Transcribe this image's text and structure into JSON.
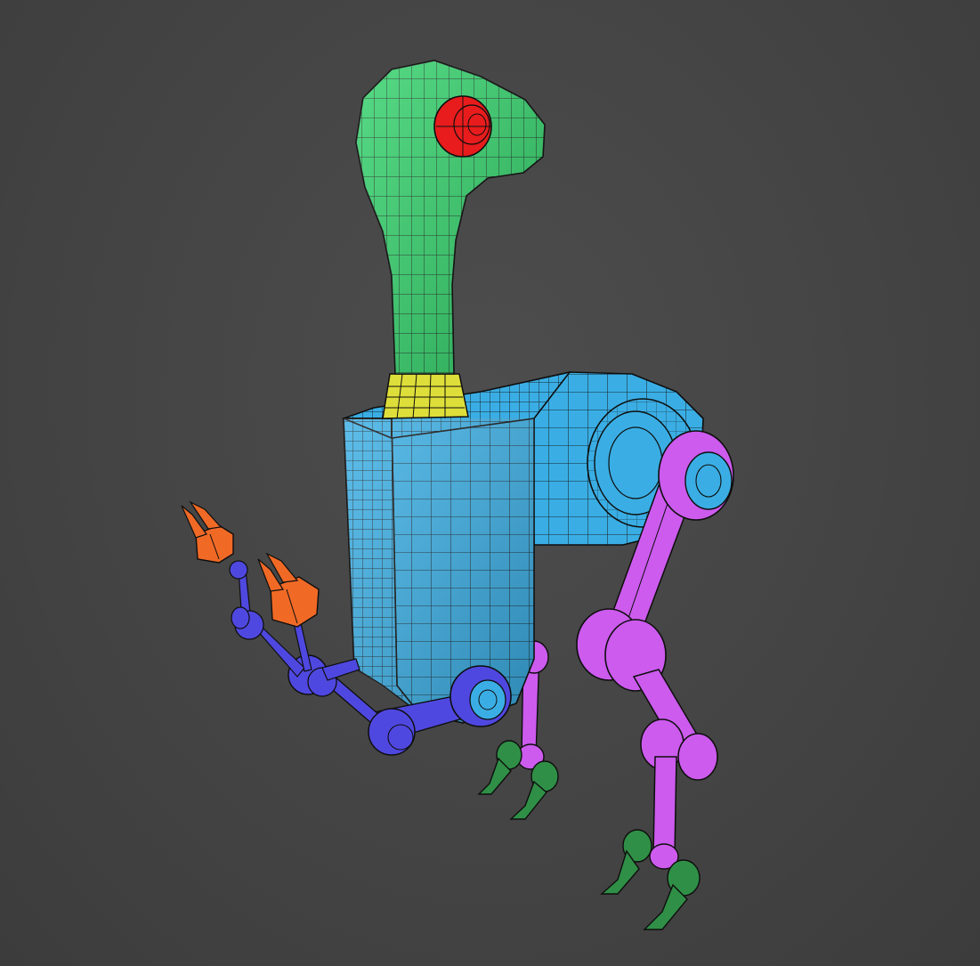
{
  "viewport": {
    "background": "#464646"
  },
  "palette": {
    "head": "#32d16a",
    "eye": "#e81c1c",
    "collar": "#dede3a",
    "body": "#3aaee4",
    "rear_legs": "#cc5bee",
    "front_arms": "#4f48e0",
    "claws": "#f06a26",
    "feet": "#2f8f46",
    "wire": "#0e0e0e"
  },
  "model": {
    "parts": [
      {
        "name": "head",
        "color_key": "head"
      },
      {
        "name": "eye",
        "color_key": "eye"
      },
      {
        "name": "neck-collar",
        "color_key": "collar"
      },
      {
        "name": "torso",
        "color_key": "body"
      },
      {
        "name": "hip-joint",
        "color_key": "body"
      },
      {
        "name": "rear-legs",
        "color_key": "rear_legs"
      },
      {
        "name": "front-arms",
        "color_key": "front_arms"
      },
      {
        "name": "claws",
        "color_key": "claws"
      },
      {
        "name": "feet",
        "color_key": "feet"
      }
    ]
  }
}
